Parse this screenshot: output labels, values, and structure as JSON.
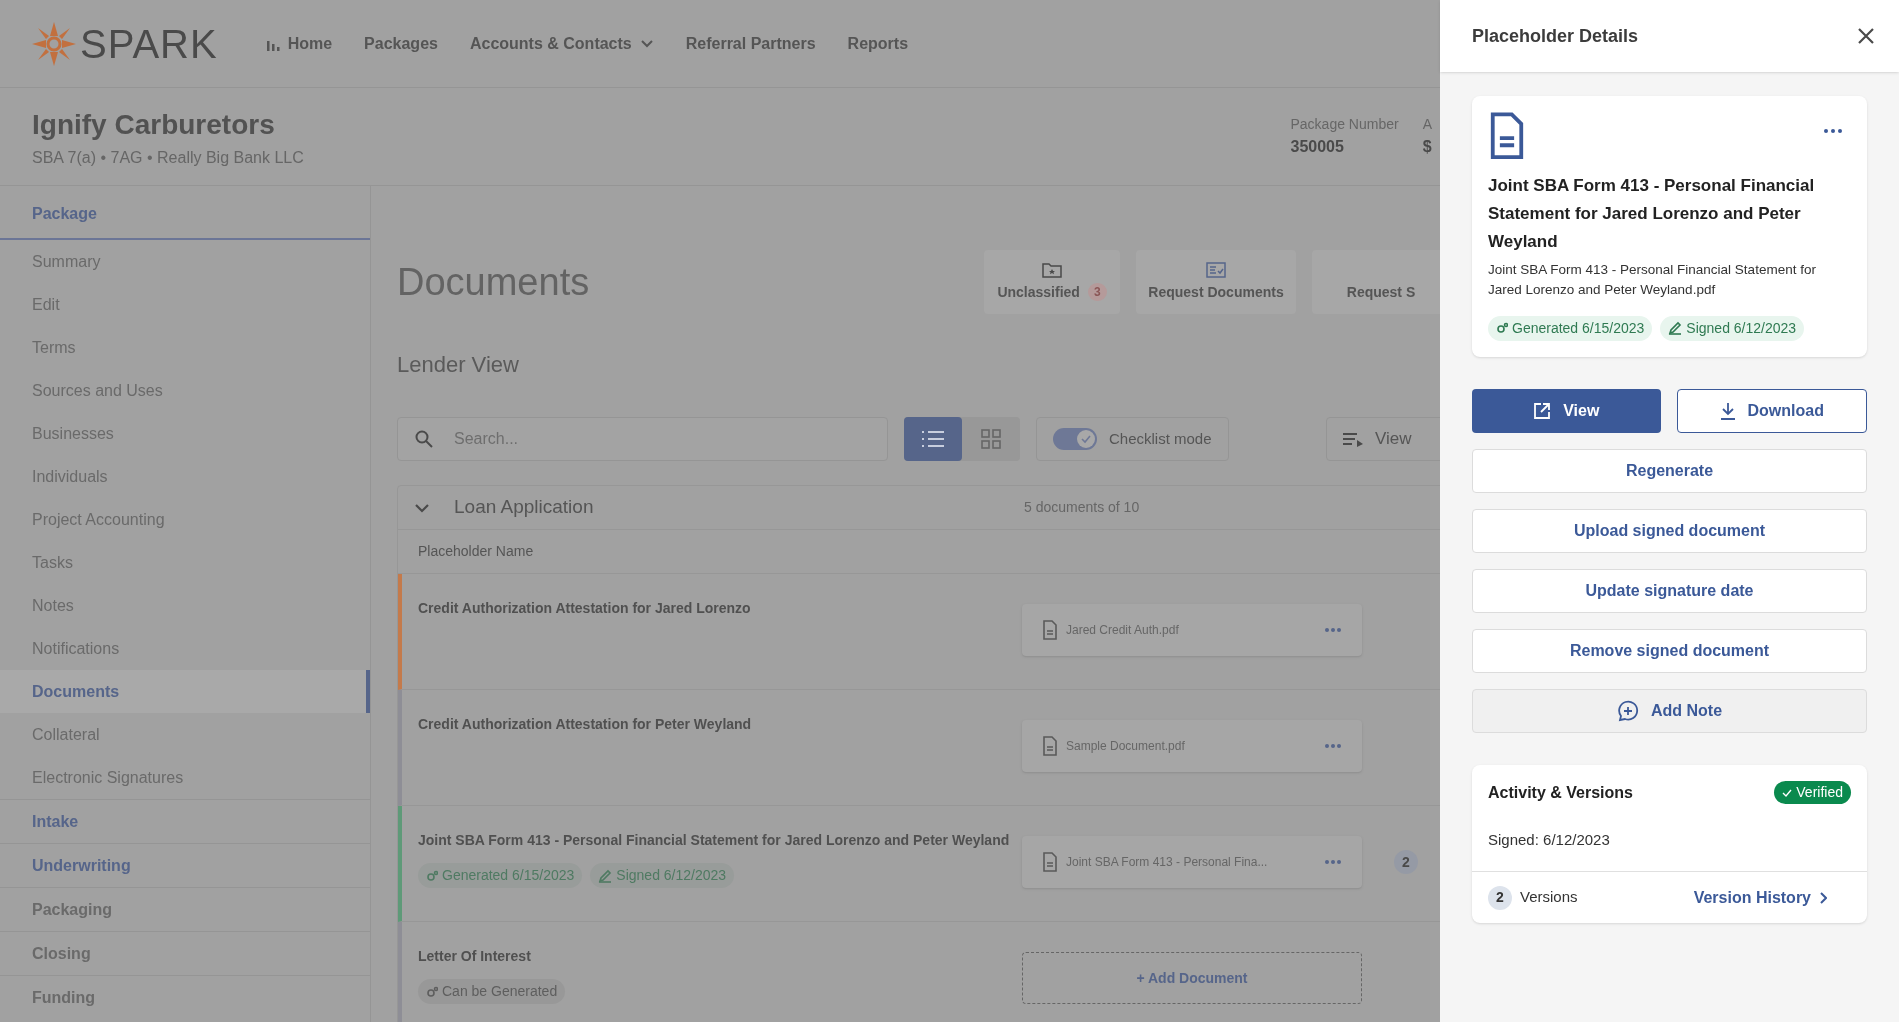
{
  "brand": {
    "name": "SPARK"
  },
  "nav": [
    {
      "label": "Home"
    },
    {
      "label": "Packages"
    },
    {
      "label": "Accounts & Contacts",
      "dropdown": true
    },
    {
      "label": "Referral Partners"
    },
    {
      "label": "Reports"
    }
  ],
  "header": {
    "title": "Ignify Carburetors",
    "subtitle": "SBA 7(a) • 7AG • Really Big Bank LLC",
    "stats": [
      {
        "label": "Package Number",
        "value": "350005"
      },
      {
        "label": "A",
        "value": "$"
      }
    ]
  },
  "sidebar": {
    "section": "Package",
    "items": [
      {
        "label": "Summary",
        "selected": false
      },
      {
        "label": "Edit",
        "selected": false
      },
      {
        "label": "Terms",
        "selected": false
      },
      {
        "label": "Sources and Uses",
        "selected": false
      },
      {
        "label": "Businesses",
        "selected": false
      },
      {
        "label": "Individuals",
        "selected": false
      },
      {
        "label": "Project Accounting",
        "selected": false
      },
      {
        "label": "Tasks",
        "selected": false
      },
      {
        "label": "Notes",
        "selected": false
      },
      {
        "label": "Notifications",
        "selected": false
      },
      {
        "label": "Documents",
        "selected": true
      },
      {
        "label": "Collateral",
        "selected": false
      },
      {
        "label": "Electronic Signatures",
        "selected": false
      }
    ],
    "stages": [
      {
        "label": "Intake",
        "disabled": false
      },
      {
        "label": "Underwriting",
        "disabled": false
      },
      {
        "label": "Packaging",
        "disabled": true
      },
      {
        "label": "Closing",
        "disabled": true
      },
      {
        "label": "Funding",
        "disabled": true
      }
    ]
  },
  "page": {
    "title": "Documents",
    "actions": [
      {
        "label": "Unclassified",
        "count": "3"
      },
      {
        "label": "Request Documents"
      },
      {
        "label": "Request S"
      }
    ],
    "subtitle": "Lender View",
    "search": {
      "placeholder": "Search..."
    },
    "view_modes": [
      {
        "kind": "list",
        "selected": true
      },
      {
        "kind": "grid",
        "selected": false
      }
    ],
    "checklist": {
      "label": "Checklist mode",
      "on": true
    },
    "view_menu": {
      "label": "View"
    }
  },
  "group": {
    "title": "Loan Application",
    "expanded": true,
    "count": "5 documents of 10",
    "column": "Placeholder Name",
    "rows": [
      {
        "name": "Credit Authorization Attestation for Jared Lorenzo",
        "color": "#c47a4b",
        "badges": [],
        "file": "Jared Credit Auth.pdf"
      },
      {
        "name": "Credit Authorization Attestation for Peter Weyland",
        "color": "#8e8e96",
        "badges": [],
        "file": "Sample Document.pdf"
      },
      {
        "name": "Joint SBA Form 413 - Personal Financial Statement for Jared Lorenzo and Peter Weyland",
        "color": "#5e9a78",
        "badges": [
          {
            "kind": "generated",
            "label": "Generated 6/15/2023"
          },
          {
            "kind": "signed",
            "label": "Signed 6/12/2023"
          }
        ],
        "file": "Joint SBA Form 413 - Personal Fina...",
        "versions": "2"
      },
      {
        "name": "Letter Of Interest",
        "color": "#8e8e96",
        "badges": [
          {
            "kind": "can_generate",
            "label": "Can be Generated"
          }
        ],
        "add_label": "+ Add Document"
      }
    ]
  },
  "drawer": {
    "title": "Placeholder Details",
    "card": {
      "title": "Joint SBA Form 413 - Personal Financial Statement for Jared Lorenzo and Peter Weyland",
      "filename": "Joint SBA Form 413 - Personal Financial Statement for Jared Lorenzo and Peter Weyland.pdf",
      "badges": [
        {
          "kind": "generated",
          "label": "Generated 6/15/2023"
        },
        {
          "kind": "signed",
          "label": "Signed 6/12/2023"
        }
      ]
    },
    "primary_buttons": [
      {
        "kind": "primary",
        "label": "View"
      },
      {
        "kind": "outline",
        "label": "Download"
      }
    ],
    "buttons": [
      {
        "kind": "plain",
        "label": "Regenerate"
      },
      {
        "kind": "plain",
        "label": "Upload signed document"
      },
      {
        "kind": "plain",
        "label": "Update signature date"
      },
      {
        "kind": "plain",
        "label": "Remove signed document"
      },
      {
        "kind": "note",
        "label": "Add Note"
      }
    ],
    "activity": {
      "title": "Activity & Versions",
      "status": "Verified",
      "signed": "Signed: 6/12/2023",
      "versions_count": "2",
      "versions_label": "Versions",
      "history_link": "Version History"
    }
  }
}
